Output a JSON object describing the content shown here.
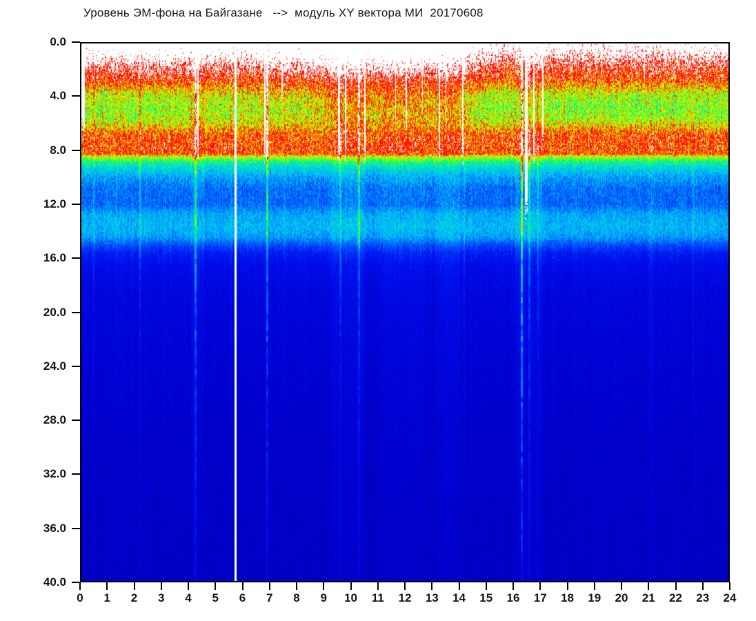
{
  "title": "Уровень ЭМ-фона на Байгазане   -->  модуль XY вектора МИ  20170608",
  "colors": {
    "background": "#ffffff",
    "axis": "#000000",
    "label": "#141414"
  },
  "chart_data": {
    "type": "heatmap",
    "title": "Уровень ЭМ-фона на Байгазане   -->  модуль XY вектора МИ  20170608",
    "xlabel": "",
    "ylabel": "",
    "x_axis": {
      "min": 0,
      "max": 24,
      "tick_step": 1,
      "tick_labels": [
        "0",
        "1",
        "2",
        "3",
        "4",
        "5",
        "6",
        "7",
        "8",
        "9",
        "10",
        "11",
        "12",
        "13",
        "14",
        "15",
        "16",
        "17",
        "18",
        "19",
        "20",
        "21",
        "22",
        "23",
        "24"
      ]
    },
    "y_axis": {
      "min": 0,
      "max": 40,
      "tick_step": 4,
      "inverted": true,
      "tick_labels": [
        "0.0",
        "4.0",
        "8.0",
        "12.0",
        "16.0",
        "20.0",
        "24.0",
        "28.0",
        "32.0",
        "36.0",
        "40.0"
      ]
    },
    "legend": "none",
    "grid": false,
    "colormap": {
      "over": "#FFFFFF",
      "white_clip_threshold": 1.02,
      "stops": [
        [
          0.0,
          "#0000A0"
        ],
        [
          0.12,
          "#0000CC"
        ],
        [
          0.22,
          "#0010F0"
        ],
        [
          0.33,
          "#0060FF"
        ],
        [
          0.44,
          "#00C0F8"
        ],
        [
          0.54,
          "#00E8C0"
        ],
        [
          0.62,
          "#20FF50"
        ],
        [
          0.71,
          "#A0FF00"
        ],
        [
          0.78,
          "#E8F000"
        ],
        [
          0.84,
          "#FF9000"
        ],
        [
          0.88,
          "#FF2800"
        ],
        [
          1.0,
          "#FF0000"
        ]
      ]
    },
    "depth_profile_mean": [
      [
        0,
        1.32
      ],
      [
        1,
        1.18
      ],
      [
        2,
        1.02
      ],
      [
        2.6,
        0.95
      ],
      [
        3.2,
        0.9
      ],
      [
        4,
        0.85
      ],
      [
        5,
        0.82
      ],
      [
        6,
        0.83
      ],
      [
        6.6,
        0.87
      ],
      [
        7.2,
        0.9
      ],
      [
        8.2,
        0.89
      ],
      [
        8.5,
        0.7
      ],
      [
        8.8,
        0.58
      ],
      [
        9.4,
        0.47
      ],
      [
        10,
        0.4
      ],
      [
        10.8,
        0.345
      ],
      [
        12,
        0.335
      ],
      [
        12.7,
        0.41
      ],
      [
        13.6,
        0.435
      ],
      [
        14.4,
        0.4
      ],
      [
        15,
        0.3
      ],
      [
        15.6,
        0.235
      ],
      [
        16.5,
        0.195
      ],
      [
        18,
        0.17
      ],
      [
        20,
        0.155
      ],
      [
        24,
        0.135
      ],
      [
        30,
        0.115
      ],
      [
        40,
        0.1
      ]
    ],
    "noise_amplitude": [
      [
        0,
        0.27
      ],
      [
        1.5,
        0.26
      ],
      [
        3,
        0.24
      ],
      [
        8.0,
        0.23
      ],
      [
        8.4,
        0.15
      ],
      [
        10,
        0.12
      ],
      [
        12,
        0.11
      ],
      [
        14.5,
        0.1
      ],
      [
        15.5,
        0.055
      ],
      [
        17,
        0.04
      ],
      [
        20,
        0.032
      ],
      [
        26,
        0.027
      ],
      [
        40,
        0.024
      ]
    ],
    "green_band": {
      "center": 4.7,
      "half_width": 2.0,
      "max_dip": 0.16,
      "time_factor": [
        [
          0,
          0.8
        ],
        [
          2,
          0.85
        ],
        [
          3.5,
          0.8
        ],
        [
          4.4,
          0.6
        ],
        [
          5,
          0.65
        ],
        [
          6,
          0.6
        ],
        [
          7,
          0.55
        ],
        [
          8.3,
          0.5
        ],
        [
          9,
          0.2
        ],
        [
          13.5,
          0.18
        ],
        [
          14.5,
          0.55
        ],
        [
          15.3,
          0.85
        ],
        [
          17,
          0.8
        ],
        [
          19,
          0.85
        ],
        [
          22,
          0.85
        ],
        [
          24,
          0.8
        ]
      ]
    },
    "surface_shift": [
      [
        0,
        0.25
      ],
      [
        2,
        0.3
      ],
      [
        3,
        0.05
      ],
      [
        4.5,
        0.3
      ],
      [
        5.5,
        0.35
      ],
      [
        6.5,
        0.1
      ],
      [
        8,
        -0.1
      ],
      [
        9,
        -0.3
      ],
      [
        13,
        -0.35
      ],
      [
        14,
        -0.1
      ],
      [
        14.8,
        0.4
      ],
      [
        15.6,
        0.8
      ],
      [
        16.5,
        0.85
      ],
      [
        17.2,
        0.55
      ],
      [
        18,
        0.8
      ],
      [
        19.5,
        0.7
      ],
      [
        21,
        0.8
      ],
      [
        22.5,
        0.7
      ],
      [
        24,
        0.7
      ]
    ],
    "white_gap_columns": [
      {
        "t": 0.06,
        "w": 0.14,
        "d_max": 6.2
      },
      {
        "t": 4.33,
        "w": 0.05,
        "d_max": 8.4
      },
      {
        "t": 5.03,
        "w": 0.04,
        "d_max": 3.2
      },
      {
        "t": 5.72,
        "w": 0.07,
        "d_max": 40
      },
      {
        "t": 6.8,
        "w": 0.05,
        "d_max": 8.4
      },
      {
        "t": 7.45,
        "w": 0.04,
        "d_max": 4.0
      },
      {
        "t": 9.55,
        "w": 0.08,
        "d_max": 8.4
      },
      {
        "t": 9.8,
        "w": 0.05,
        "d_max": 8.4
      },
      {
        "t": 10.52,
        "w": 0.05,
        "d_max": 8.4
      },
      {
        "t": 11.65,
        "w": 0.04,
        "d_max": 6.0
      },
      {
        "t": 12.05,
        "w": 0.04,
        "d_max": 6.0
      },
      {
        "t": 12.65,
        "w": 0.04,
        "d_max": 5.0
      },
      {
        "t": 13.28,
        "w": 0.06,
        "d_max": 8.4
      },
      {
        "t": 13.52,
        "w": 0.04,
        "d_max": 6.0
      },
      {
        "t": 14.15,
        "w": 0.05,
        "d_max": 8.4
      },
      {
        "t": 16.5,
        "w": 0.1,
        "d_max": 12.5
      },
      {
        "t": 16.78,
        "w": 0.06,
        "d_max": 8.4
      },
      {
        "t": 17.12,
        "w": 0.05,
        "d_max": 7.0
      },
      {
        "t": 19.3,
        "w": 0.03,
        "d_max": 3.0
      },
      {
        "t": 20.9,
        "w": 0.03,
        "d_max": 3.0
      }
    ],
    "bright_streak_columns": [
      {
        "t": 0.45,
        "w": 0.05,
        "amp": 0.09,
        "decay": 45
      },
      {
        "t": 1.3,
        "w": 0.04,
        "amp": 0.07,
        "decay": 45
      },
      {
        "t": 2.17,
        "w": 0.05,
        "amp": 0.22,
        "decay": 26
      },
      {
        "t": 3.06,
        "w": 0.04,
        "amp": 0.09,
        "decay": 40
      },
      {
        "t": 3.3,
        "w": 0.04,
        "amp": 0.06,
        "decay": 60
      },
      {
        "t": 4.24,
        "w": 0.08,
        "amp": 0.34,
        "decay": 34
      },
      {
        "t": 4.3,
        "w": 0.55,
        "amp": 0.03,
        "decay": 60
      },
      {
        "t": 5.55,
        "w": 0.05,
        "amp": 0.12,
        "decay": 20
      },
      {
        "t": 6.9,
        "w": 0.07,
        "amp": 0.42,
        "decay": 30
      },
      {
        "t": 7.55,
        "w": 0.04,
        "amp": 0.1,
        "decay": 25
      },
      {
        "t": 9.6,
        "w": 0.07,
        "amp": 0.17,
        "decay": 32
      },
      {
        "t": 9.9,
        "w": 1.3,
        "amp": 0.035,
        "decay": 55
      },
      {
        "t": 10.3,
        "w": 0.07,
        "amp": 0.4,
        "decay": 19
      },
      {
        "t": 11.95,
        "w": 1.6,
        "amp": 0.025,
        "decay": 55
      },
      {
        "t": 13.6,
        "w": 0.9,
        "amp": 0.035,
        "decay": 50
      },
      {
        "t": 14.2,
        "w": 0.06,
        "amp": 0.14,
        "decay": 28
      },
      {
        "t": 16.33,
        "w": 0.08,
        "amp": 0.5,
        "decay": 30
      },
      {
        "t": 16.62,
        "w": 0.06,
        "amp": 0.2,
        "decay": 42
      },
      {
        "t": 16.6,
        "w": 1.0,
        "amp": 0.04,
        "decay": 55
      },
      {
        "t": 16.95,
        "w": 0.05,
        "amp": 0.11,
        "decay": 45
      },
      {
        "t": 21.1,
        "w": 0.15,
        "amp": 0.05,
        "decay": 60
      },
      {
        "t": 22.7,
        "w": 0.06,
        "amp": 0.06,
        "decay": 55
      }
    ]
  }
}
